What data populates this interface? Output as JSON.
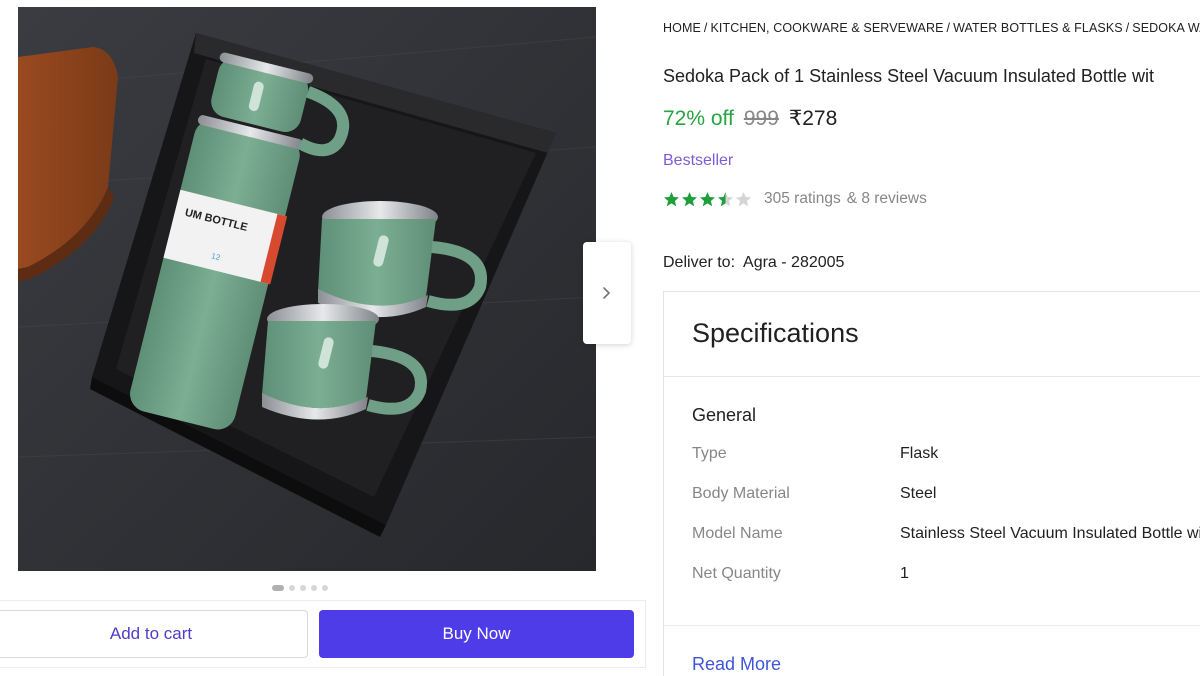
{
  "breadcrumb": [
    "HOME",
    "KITCHEN, COOKWARE & SERVEWARE",
    "WATER BOTTLES & FLASKS",
    "SEDOKA WATER BO"
  ],
  "product": {
    "title": "Sedoka Pack of 1 Stainless Steel Vacuum Insulated Bottle wit",
    "discount": "72% off",
    "mrp": "999",
    "price": "₹278",
    "badge": "Bestseller",
    "rating_value": 3.5,
    "ratings": "305 ratings",
    "reviews": "& 8 reviews",
    "bottle_label": "UM BOTTLE",
    "bottle_label_small": "12"
  },
  "delivery": {
    "label": "Deliver to:",
    "location": "Agra - 282005"
  },
  "gallery": {
    "dot_count": 5,
    "active_dot": 0
  },
  "actions": {
    "add_to_cart": "Add to cart",
    "buy_now": "Buy Now"
  },
  "specifications": {
    "heading": "Specifications",
    "group": "General",
    "rows": [
      {
        "key": "Type",
        "value": "Flask"
      },
      {
        "key": "Body Material",
        "value": "Steel"
      },
      {
        "key": "Model Name",
        "value": "Stainless Steel Vacuum Insulated Bottle wit"
      },
      {
        "key": "Net Quantity",
        "value": "1"
      }
    ],
    "read_more": "Read More"
  },
  "colors": {
    "discount_green": "#26a541",
    "buy_button": "#4d3ce8",
    "badge_purple": "#7c5cd4",
    "star_green": "#1f9e3c",
    "link_blue": "#3d55d6"
  },
  "icons": {
    "next": "chevron-right-icon",
    "star": "star-icon"
  }
}
